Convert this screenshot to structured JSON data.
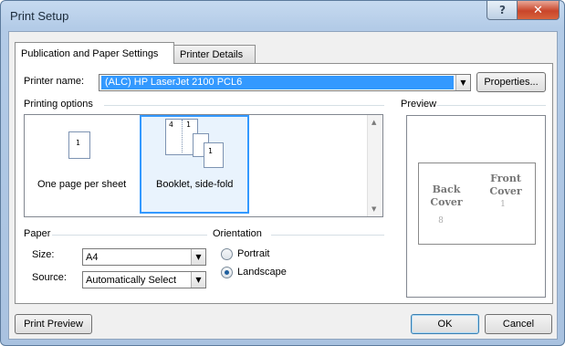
{
  "window": {
    "title": "Print Setup",
    "help_label": "?",
    "close_label": "✕"
  },
  "tabs": [
    {
      "label": "Publication and Paper Settings",
      "active": true
    },
    {
      "label": "Printer Details",
      "active": false
    }
  ],
  "printer": {
    "label": "Printer name:",
    "value": "(ALC) HP LaserJet 2100 PCL6",
    "properties_button": "Properties..."
  },
  "printing_options": {
    "group_label": "Printing options",
    "options": [
      {
        "label": "One page per sheet",
        "selected": false,
        "page_numbers": [
          "1"
        ]
      },
      {
        "label": "Booklet, side-fold",
        "selected": true,
        "page_numbers": [
          "4",
          "1",
          "1"
        ]
      }
    ]
  },
  "preview": {
    "group_label": "Preview",
    "back_cover": "Back\nCover",
    "front_cover": "Front\nCover",
    "back_page_num": "8",
    "front_page_num": "1"
  },
  "paper": {
    "group_label": "Paper",
    "size_label": "Size:",
    "size_value": "A4",
    "source_label": "Source:",
    "source_value": "Automatically Select"
  },
  "orientation": {
    "group_label": "Orientation",
    "portrait": "Portrait",
    "landscape": "Landscape",
    "selected": "landscape"
  },
  "footer": {
    "print_preview": "Print Preview",
    "ok": "OK",
    "cancel": "Cancel"
  }
}
